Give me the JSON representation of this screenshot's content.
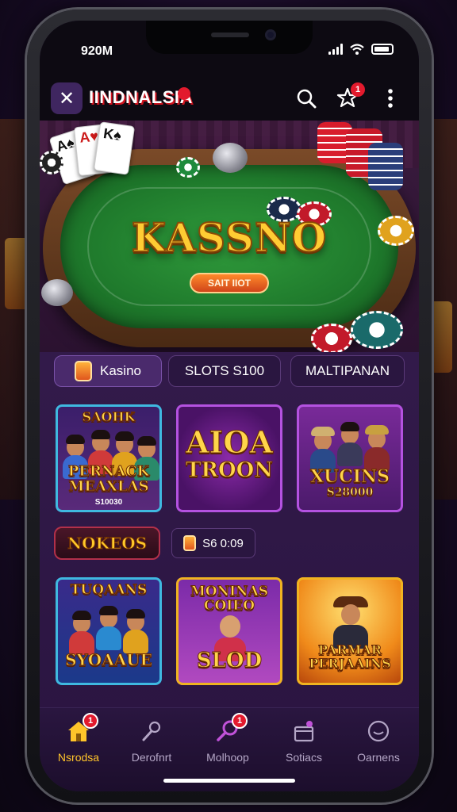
{
  "status_bar": {
    "time": "920M"
  },
  "header": {
    "brand": "IINDNALSIA",
    "close_glyph": "✕",
    "notification_count": "1"
  },
  "hero": {
    "title": "KASSNO",
    "button_label": "SAIT IIOT"
  },
  "tabs": [
    {
      "label": "Kasino",
      "active": true
    },
    {
      "label": "SLOTS S100",
      "active": false
    },
    {
      "label": "MALTIPANAN",
      "active": false
    }
  ],
  "games_row1": [
    {
      "title_top": "SAOHK",
      "title_main": "PERNACK MEAXLAS",
      "subtitle": "S10030"
    },
    {
      "title_top": "AIOA",
      "title_main": "TROON",
      "subtitle": ""
    },
    {
      "title_top": "",
      "title_main": "XUCINS",
      "subtitle": "S28000"
    }
  ],
  "section": {
    "label": "NOKEOS",
    "timer": "S6 0:09"
  },
  "games_row2": [
    {
      "title_top": "TUQAANS",
      "title_main": "SYOAAUE",
      "subtitle": ""
    },
    {
      "title_top": "MONINAS COIEO",
      "title_main": "SLOD",
      "subtitle": ""
    },
    {
      "title_top": "",
      "title_main": "PARMAR PERJAAINS",
      "subtitle": ""
    }
  ],
  "bottom_nav": [
    {
      "label": "Nsrodsa",
      "icon": "home-icon",
      "active": true,
      "badge": "1"
    },
    {
      "label": "Derofnrt",
      "icon": "mic-icon",
      "active": false,
      "badge": ""
    },
    {
      "label": "Molhoop",
      "icon": "search-icon",
      "active": false,
      "badge": "1"
    },
    {
      "label": "Sotiacs",
      "icon": "gift-icon",
      "active": false,
      "badge": ""
    },
    {
      "label": "Oarnens",
      "icon": "smiley-icon",
      "active": false,
      "badge": ""
    }
  ],
  "colors": {
    "accent": "#ffc42a",
    "badge": "#e21a2d",
    "panel": "#2a1640",
    "tile_border_cyan": "#3fb9e0",
    "tile_border_purple": "#b452e0"
  }
}
